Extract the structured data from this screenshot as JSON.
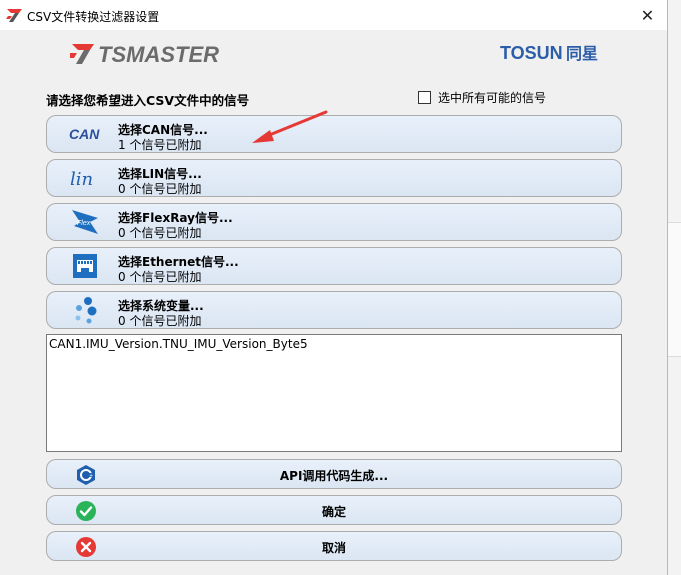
{
  "window": {
    "title": "CSV文件转换过滤器设置",
    "close_glyph": "✕"
  },
  "brand": {
    "left_logo": "TSMASTER",
    "left_logo_prefix": "7",
    "right_logo_latin": "TOSUN",
    "right_logo_cjk": "同星",
    "accent_red": "#e53935",
    "logo_gray": "#6b6b6b",
    "tosun_blue": "#2b5da8"
  },
  "prompt": "请选择您希望进入CSV文件中的信号",
  "select_all_label": "选中所有可能的信号",
  "signal_buttons": [
    {
      "icon": "can-icon",
      "title": "选择CAN信号...",
      "status": "1 个信号已附加"
    },
    {
      "icon": "lin-icon",
      "title": "选择LIN信号...",
      "status": "0 个信号已附加"
    },
    {
      "icon": "flexray-icon",
      "title": "选择FlexRay信号...",
      "status": "0 个信号已附加"
    },
    {
      "icon": "ethernet-icon",
      "title": "选择Ethernet信号...",
      "status": "0 个信号已附加"
    },
    {
      "icon": "system-variable-icon",
      "title": "选择系统变量...",
      "status": "0 个信号已附加"
    }
  ],
  "selected_signals": [
    "CAN1.IMU_Version.TNU_IMU_Version_Byte5"
  ],
  "icon_texts": {
    "can": "CAN",
    "lin": "lin",
    "flex": "Flex"
  },
  "actions": {
    "api": "API调用代码生成...",
    "ok": "确定",
    "cancel": "取消"
  }
}
